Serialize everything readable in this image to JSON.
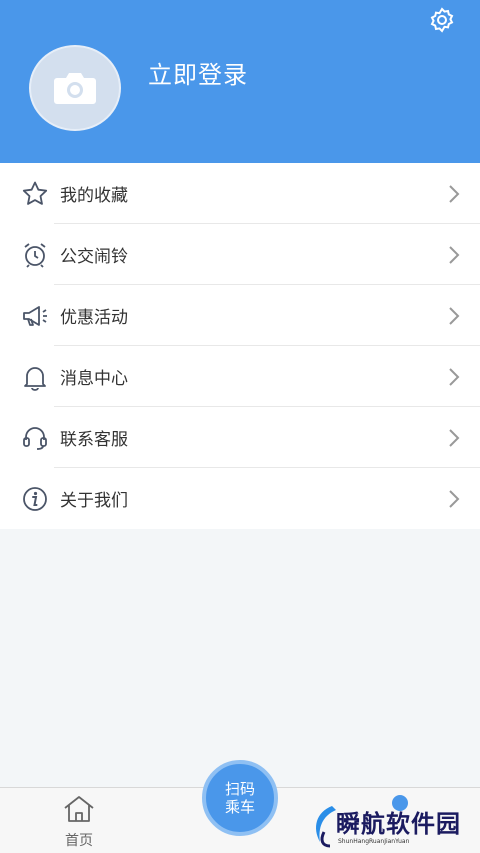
{
  "header": {
    "login_label": "立即登录"
  },
  "menu": {
    "items": [
      {
        "label": "我的收藏",
        "icon": "star-icon"
      },
      {
        "label": "公交闹铃",
        "icon": "alarm-clock-icon"
      },
      {
        "label": "优惠活动",
        "icon": "megaphone-icon"
      },
      {
        "label": "消息中心",
        "icon": "bell-icon"
      },
      {
        "label": "联系客服",
        "icon": "headset-icon"
      },
      {
        "label": "关于我们",
        "icon": "info-icon"
      }
    ]
  },
  "tabbar": {
    "home_label": "首页",
    "scan_line1": "扫码",
    "scan_line2": "乘车"
  },
  "watermark": {
    "name": "瞬航软件园",
    "sub": "ShunHangRuanJianYuan"
  },
  "colors": {
    "primary": "#4a97ea",
    "background": "#f3f6f8",
    "text": "#333333"
  }
}
